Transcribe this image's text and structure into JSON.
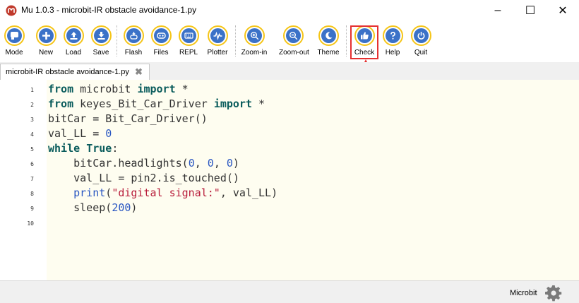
{
  "window": {
    "title": "Mu 1.0.3 - microbit-IR obstacle avoidance-1.py",
    "minimize": "–",
    "maximize": "☐",
    "close": "✕"
  },
  "toolbar": {
    "buttons": [
      {
        "label": "Mode",
        "icon": "mode-icon"
      },
      {
        "label": "New",
        "icon": "plus-icon"
      },
      {
        "label": "Load",
        "icon": "upload-icon"
      },
      {
        "label": "Save",
        "icon": "download-icon"
      },
      {
        "label": "Flash",
        "icon": "flash-icon"
      },
      {
        "label": "Files",
        "icon": "files-icon"
      },
      {
        "label": "REPL",
        "icon": "keyboard-icon"
      },
      {
        "label": "Plotter",
        "icon": "pulse-icon"
      },
      {
        "label": "Zoom-in",
        "icon": "zoom-in-icon"
      },
      {
        "label": "Zoom-out",
        "icon": "zoom-out-icon"
      },
      {
        "label": "Theme",
        "icon": "moon-icon"
      },
      {
        "label": "Check",
        "icon": "thumbs-up-icon"
      },
      {
        "label": "Help",
        "icon": "question-icon"
      },
      {
        "label": "Quit",
        "icon": "power-icon"
      }
    ]
  },
  "tab": {
    "label": "microbit-IR obstacle avoidance-1.py",
    "close": "✖"
  },
  "editor": {
    "line_numbers": [
      "1",
      "2",
      "3",
      "4",
      "5",
      "6",
      "7",
      "8",
      "9",
      "10"
    ],
    "lines": [
      "from microbit import *",
      "from keyes_Bit_Car_Driver import *",
      "bitCar = Bit_Car_Driver()",
      "val_LL = 0",
      "while True:",
      "    bitCar.headlights(0, 0, 0)",
      "    val_LL = pin2.is_touched()",
      "    print(\"digital signal:\", val_LL)",
      "    sleep(200)",
      ""
    ]
  },
  "status": {
    "mode": "Microbit"
  },
  "colors": {
    "accent_ring": "#f5c518",
    "button_fill": "#3b72c8",
    "highlight": "#e53030",
    "editor_bg": "#fefdf0"
  }
}
